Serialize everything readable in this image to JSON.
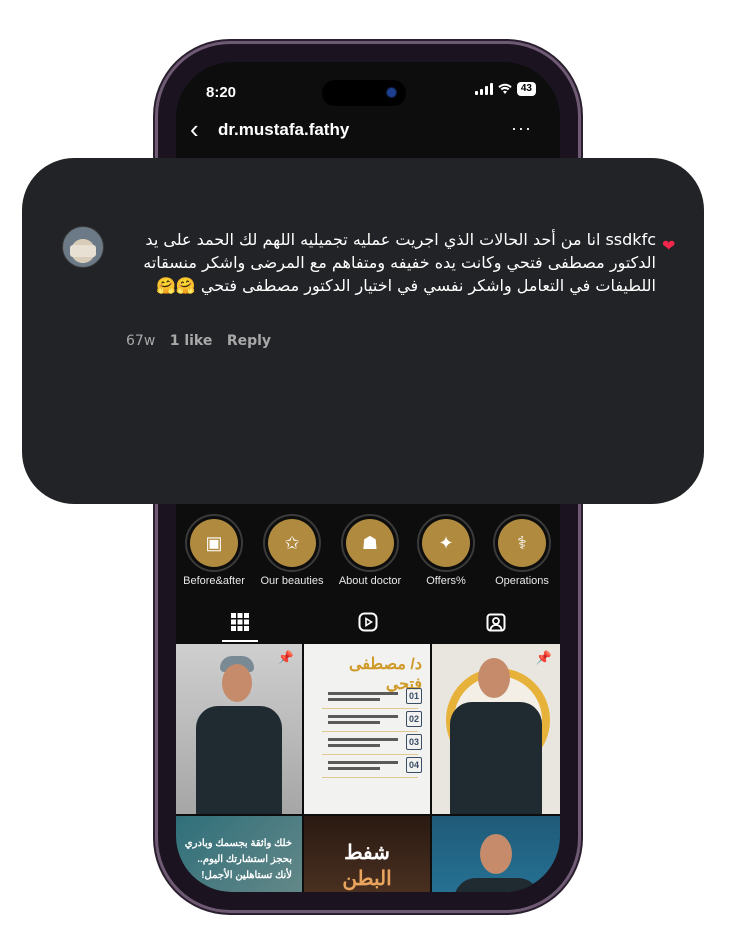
{
  "status": {
    "time": "8:20",
    "battery": "43"
  },
  "header": {
    "back": "‹",
    "username": "dr.mustafa.fathy",
    "more": "···"
  },
  "comment": {
    "text": "ssdkfc انا من أحد الحالات الذي اجريت عمليه تجميليه اللهم لك الحمد على يد الدكتور مصطفى فتحي وكانت يده خفيفه ومتفاهم مع المرضى واشكر منسقاته اللطيفات في التعامل واشكر نفسي في اختيار الدكتور مصطفى فتحي 🤗🤗",
    "age": "67w",
    "likes": "1 like",
    "reply": "Reply"
  },
  "highlights": [
    {
      "label": "Before&after",
      "icon": "photo-collage-icon"
    },
    {
      "label": "Our beauties",
      "icon": "stars-icon"
    },
    {
      "label": "About doctor",
      "icon": "doctor-icon"
    },
    {
      "label": "Offers%",
      "icon": "gift-icon"
    },
    {
      "label": "Operations",
      "icon": "surgery-bed-icon"
    }
  ],
  "tabs": [
    {
      "name": "grid",
      "icon": "grid-icon"
    },
    {
      "name": "reels",
      "icon": "reels-icon"
    },
    {
      "name": "tagged",
      "icon": "tagged-icon"
    }
  ],
  "posts": {
    "post2_title": "د/ مصطفى فتحي",
    "post2_items": [
      "01",
      "02",
      "03",
      "04"
    ],
    "post4_text": "خلك واثقة بجسمك وبادري بحجز استشارتك اليوم.. لأنك تستاهلين الأجمل!",
    "post5_title": "شفط",
    "post5_subtitle": "البطن"
  },
  "colors": {
    "popup_bg": "#222326",
    "heart": "#f0264a",
    "accent_gold": "#e6b23a"
  }
}
